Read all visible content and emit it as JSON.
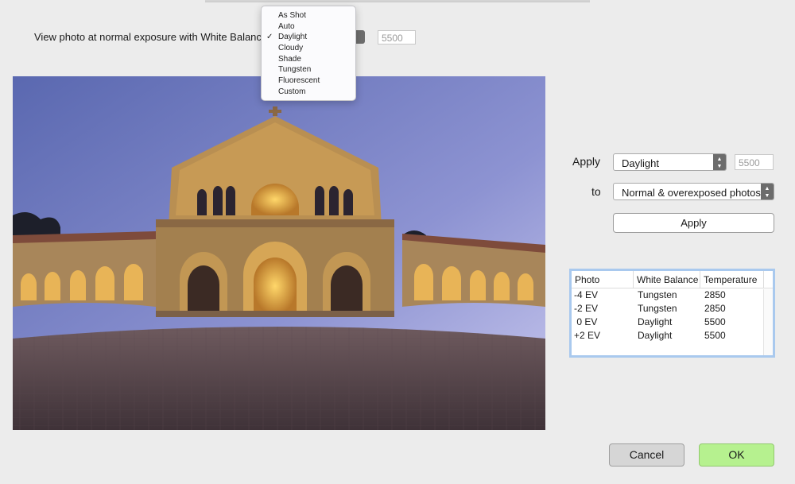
{
  "header": {
    "view_label": "View photo at normal exposure with White Balance:",
    "temperature": "5500"
  },
  "wb_menu": {
    "items": [
      "As Shot",
      "Auto",
      "Daylight",
      "Cloudy",
      "Shade",
      "Tungsten",
      "Fluorescent",
      "Custom"
    ],
    "checked": "Daylight",
    "check_mark": "✓"
  },
  "apply_panel": {
    "apply_label": "Apply",
    "wb_value": "Daylight",
    "temperature": "5500",
    "to_label": "to",
    "target_value": "Normal & overexposed photos",
    "apply_button": "Apply"
  },
  "table": {
    "columns": [
      "Photo",
      "White Balance",
      "Temperature"
    ],
    "rows": [
      [
        "-4 EV",
        "Tungsten",
        "2850"
      ],
      [
        "-2 EV",
        "Tungsten",
        "2850"
      ],
      [
        " 0 EV",
        "Daylight",
        "5500"
      ],
      [
        "+2 EV",
        "Daylight",
        "5500"
      ]
    ]
  },
  "buttons": {
    "cancel": "Cancel",
    "ok": "OK"
  },
  "colors": {
    "ok_button": "#b6f18f",
    "table_focus_ring": "#a9c9ee",
    "background": "#ececec"
  }
}
